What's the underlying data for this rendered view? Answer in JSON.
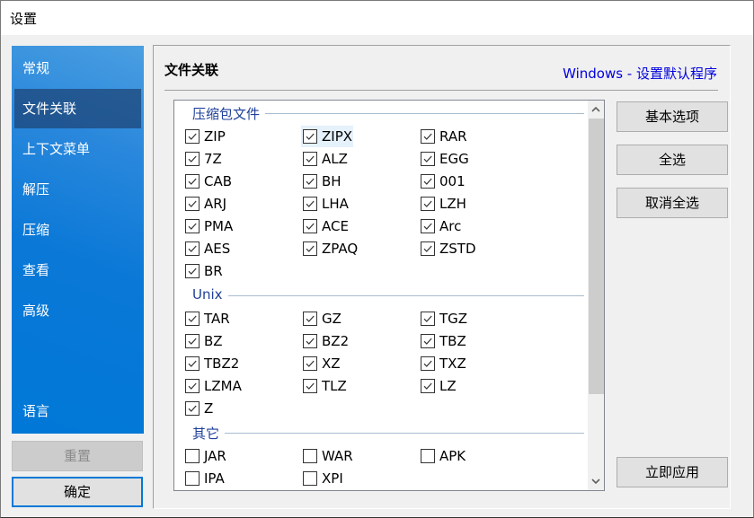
{
  "window": {
    "title": "设置"
  },
  "sidebar": {
    "items": [
      {
        "label": "常规",
        "active": false
      },
      {
        "label": "文件关联",
        "active": true
      },
      {
        "label": "上下文菜单",
        "active": false
      },
      {
        "label": "解压",
        "active": false
      },
      {
        "label": "压缩",
        "active": false
      },
      {
        "label": "查看",
        "active": false
      },
      {
        "label": "高级",
        "active": false
      }
    ],
    "bottom_item": {
      "label": "语言"
    },
    "reset_label": "重置",
    "ok_label": "确定"
  },
  "panel": {
    "title": "文件关联",
    "link": "Windows - 设置默认程序"
  },
  "groups": [
    {
      "name": "压缩包文件",
      "items": [
        {
          "label": "ZIP",
          "checked": true
        },
        {
          "label": "ZIPX",
          "checked": true,
          "hover": true
        },
        {
          "label": "RAR",
          "checked": true
        },
        {
          "label": "7Z",
          "checked": true
        },
        {
          "label": "ALZ",
          "checked": true
        },
        {
          "label": "EGG",
          "checked": true
        },
        {
          "label": "CAB",
          "checked": true
        },
        {
          "label": "BH",
          "checked": true
        },
        {
          "label": "001",
          "checked": true
        },
        {
          "label": "ARJ",
          "checked": true
        },
        {
          "label": "LHA",
          "checked": true
        },
        {
          "label": "LZH",
          "checked": true
        },
        {
          "label": "PMA",
          "checked": true
        },
        {
          "label": "ACE",
          "checked": true
        },
        {
          "label": "Arc",
          "checked": true
        },
        {
          "label": "AES",
          "checked": true
        },
        {
          "label": "ZPAQ",
          "checked": true
        },
        {
          "label": "ZSTD",
          "checked": true
        },
        {
          "label": "BR",
          "checked": true
        }
      ]
    },
    {
      "name": "Unix",
      "items": [
        {
          "label": "TAR",
          "checked": true
        },
        {
          "label": "GZ",
          "checked": true
        },
        {
          "label": "TGZ",
          "checked": true
        },
        {
          "label": "BZ",
          "checked": true
        },
        {
          "label": "BZ2",
          "checked": true
        },
        {
          "label": "TBZ",
          "checked": true
        },
        {
          "label": "TBZ2",
          "checked": true
        },
        {
          "label": "XZ",
          "checked": true
        },
        {
          "label": "TXZ",
          "checked": true
        },
        {
          "label": "LZMA",
          "checked": true
        },
        {
          "label": "TLZ",
          "checked": true
        },
        {
          "label": "LZ",
          "checked": true
        },
        {
          "label": "Z",
          "checked": true
        }
      ]
    },
    {
      "name": "其它",
      "items": [
        {
          "label": "JAR",
          "checked": false
        },
        {
          "label": "WAR",
          "checked": false
        },
        {
          "label": "APK",
          "checked": false
        },
        {
          "label": "IPA",
          "checked": false
        },
        {
          "label": "XPI",
          "checked": false
        }
      ]
    }
  ],
  "actions": {
    "basic_options": "基本选项",
    "select_all": "全选",
    "deselect_all": "取消全选",
    "apply_now": "立即应用"
  },
  "scroll": {
    "position_fraction": 0.0,
    "visible_fraction": 0.78
  }
}
